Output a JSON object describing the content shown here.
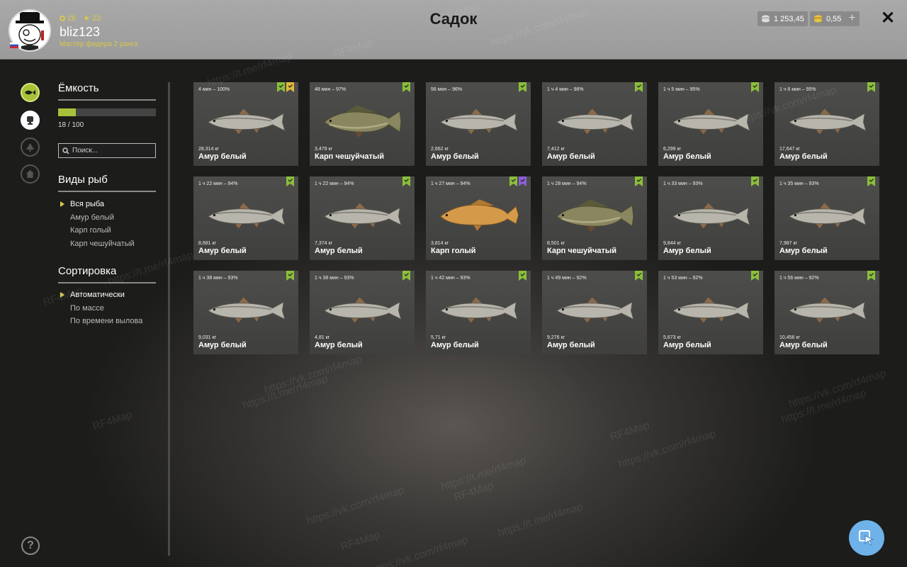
{
  "header": {
    "title": "Садок",
    "username": "bliz123",
    "rank": "Мастер фидера 2 ранга",
    "level_1": "26",
    "level_2": "23",
    "silver": "1 253,45",
    "gold": "0,55",
    "plus_label": "+",
    "close_label": "✕"
  },
  "sidebar": {
    "capacity_title": "Ёмкость",
    "capacity_text": "18 / 100",
    "capacity_fraction": 0.18,
    "search_placeholder": "Поиск...",
    "species_title": "Виды рыб",
    "species": [
      "Вся рыба",
      "Амур белый",
      "Карп голый",
      "Карп чешуйчатый"
    ],
    "sort_title": "Сортировка",
    "sort_options": [
      "Автоматически",
      "По массе",
      "По времени вылова"
    ],
    "help_label": "?"
  },
  "watermarks": [
    "RF4Map",
    "https://vk.com/rf4map",
    "https://t.me/rf4map"
  ],
  "colors": {
    "accent": "#a7c23a",
    "badge_green": "#8bbf3a",
    "badge_yellow": "#e0b83a",
    "badge_purple": "#8c5fd6",
    "fab": "#6fb2e9"
  },
  "fish_cards": [
    {
      "time": "4 мин – 100%",
      "weight": "28,314 кг",
      "name": "Амур белый",
      "type": "grass",
      "badges": [
        "green",
        "yellow"
      ]
    },
    {
      "time": "48 мин – 97%",
      "weight": "3,479 кг",
      "name": "Карп чешуйчатый",
      "type": "scaled",
      "badges": [
        "green"
      ]
    },
    {
      "time": "56 мин – 96%",
      "weight": "2,662 кг",
      "name": "Амур белый",
      "type": "grass",
      "badges": [
        "green"
      ]
    },
    {
      "time": "1 ч 4 мин – 96%",
      "weight": "7,412 кг",
      "name": "Амур белый",
      "type": "grass",
      "badges": [
        "green"
      ]
    },
    {
      "time": "1 ч 5 мин – 95%",
      "weight": "6,299 кг",
      "name": "Амур белый",
      "type": "grass",
      "badges": [
        "green"
      ]
    },
    {
      "time": "1 ч 6 мин – 95%",
      "weight": "17,647 кг",
      "name": "Амур белый",
      "type": "grass",
      "badges": [
        "green"
      ]
    },
    {
      "time": "1 ч 22 мин – 94%",
      "weight": "8,681 кг",
      "name": "Амур белый",
      "type": "grass",
      "badges": [
        "green"
      ]
    },
    {
      "time": "1 ч 22 мин – 94%",
      "weight": "7,374 кг",
      "name": "Амур белый",
      "type": "grass",
      "badges": [
        "green"
      ]
    },
    {
      "time": "1 ч 27 мин – 94%",
      "weight": "3,814 кг",
      "name": "Карп голый",
      "type": "mirror",
      "badges": [
        "green",
        "purple"
      ]
    },
    {
      "time": "1 ч 28 мин – 94%",
      "weight": "8,501 кг",
      "name": "Карп чешуйчатый",
      "type": "scaled",
      "badges": [
        "green"
      ]
    },
    {
      "time": "1 ч 33 мин – 93%",
      "weight": "9,844 кг",
      "name": "Амур белый",
      "type": "grass",
      "badges": [
        "green"
      ]
    },
    {
      "time": "1 ч 35 мин – 93%",
      "weight": "7,987 кг",
      "name": "Амур белый",
      "type": "grass",
      "badges": [
        "green"
      ]
    },
    {
      "time": "1 ч 38 мин – 93%",
      "weight": "9,031 кг",
      "name": "Амур белый",
      "type": "grass",
      "badges": [
        "green"
      ]
    },
    {
      "time": "1 ч 38 мин – 93%",
      "weight": "4,81 кг",
      "name": "Амур белый",
      "type": "grass",
      "badges": [
        "green"
      ]
    },
    {
      "time": "1 ч 42 мин – 93%",
      "weight": "5,71 кг",
      "name": "Амур белый",
      "type": "grass",
      "badges": [
        "green"
      ]
    },
    {
      "time": "1 ч 49 мин – 92%",
      "weight": "9,276 кг",
      "name": "Амур белый",
      "type": "grass",
      "badges": [
        "green"
      ]
    },
    {
      "time": "1 ч 53 мин – 92%",
      "weight": "5,673 кг",
      "name": "Амур белый",
      "type": "grass",
      "badges": [
        "green"
      ]
    },
    {
      "time": "1 ч 56 мин – 92%",
      "weight": "10,456 кг",
      "name": "Амур белый",
      "type": "grass",
      "badges": [
        "green"
      ]
    }
  ]
}
